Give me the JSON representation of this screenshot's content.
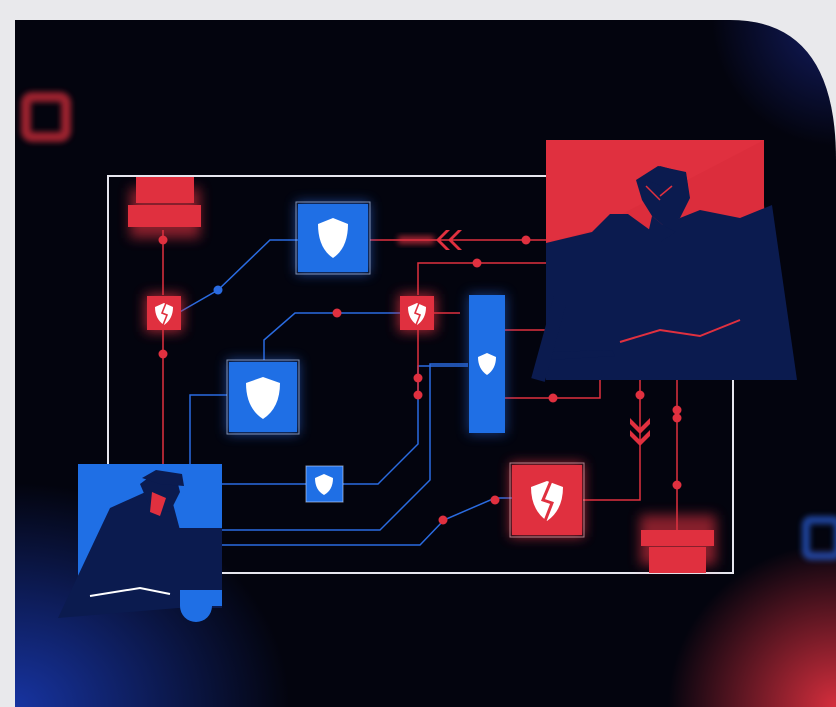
{
  "illustration": {
    "theme": "network-security",
    "colors": {
      "page_bg": "#e9e9ec",
      "panel_bg": "#03040e",
      "blue_accent": "#1f6fe5",
      "red_accent": "#e0303f",
      "navy_figure": "#0b1b4f",
      "frame_line": "#e6e6ee"
    },
    "nodes": [
      {
        "id": "shield-node-large-top",
        "color": "blue",
        "icon": "shield-icon"
      },
      {
        "id": "shield-node-large-left",
        "color": "blue",
        "icon": "shield-icon"
      },
      {
        "id": "shield-node-small-bottom",
        "color": "blue",
        "icon": "shield-icon"
      },
      {
        "id": "shield-node-tall",
        "color": "blue",
        "icon": "shield-icon"
      },
      {
        "id": "shield-node-red-left",
        "color": "red",
        "icon": "broken-shield-icon"
      },
      {
        "id": "shield-node-red-mid",
        "color": "red",
        "icon": "broken-shield-icon"
      },
      {
        "id": "shield-node-red-large",
        "color": "red",
        "icon": "broken-shield-icon"
      }
    ],
    "figures": [
      {
        "id": "attacker",
        "color": "red",
        "icon": "hacker-figure-icon"
      },
      {
        "id": "defender",
        "color": "blue",
        "icon": "user-figure-icon"
      }
    ],
    "arrows": [
      {
        "id": "arrow-left",
        "color": "red",
        "icon": "double-chevron-left-icon"
      },
      {
        "id": "arrow-down",
        "color": "red",
        "icon": "double-chevron-down-icon"
      }
    ]
  }
}
